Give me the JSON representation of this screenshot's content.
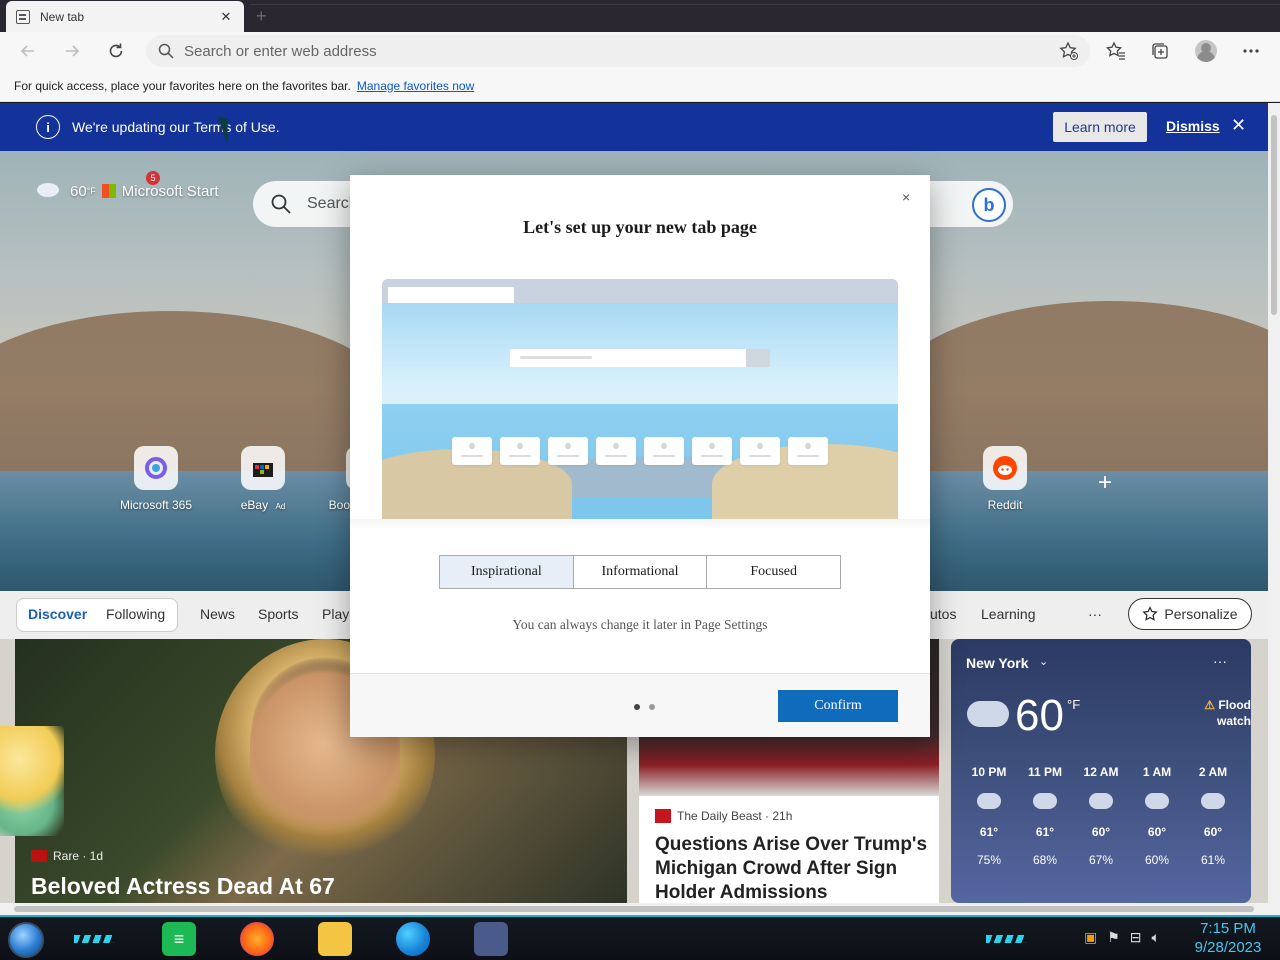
{
  "browser": {
    "tab_title": "New tab",
    "tab_close": "✕",
    "new_tab": "+",
    "address_placeholder": "Search or enter web address",
    "favorites_hint": "For quick access, place your favorites here on the favorites bar.",
    "favorites_link": "Manage favorites now"
  },
  "banner": {
    "icon": "i",
    "message": "We're updating our Terms of Use.",
    "learn_more": "Learn more",
    "dismiss": "Dismiss",
    "close": "✕"
  },
  "ntp": {
    "weather_temp": "60",
    "weather_unit": "°F",
    "brand": "Microsoft Start",
    "notification_count": "5",
    "search_placeholder": "Search",
    "bing_icon": "b",
    "quick_links": [
      {
        "label": "Microsoft 365",
        "icon": "m365-icon"
      },
      {
        "label": "eBay",
        "ad": "Ad",
        "icon": "ebay-icon"
      },
      {
        "label": "Boo",
        "icon": "booking-icon"
      },
      {
        "label": "Reddit",
        "icon": "reddit-icon"
      }
    ],
    "add_link": "+",
    "feed_tabs": {
      "discover": "Discover",
      "following": "Following",
      "news": "News",
      "sports": "Sports",
      "play": "Play",
      "autos": "utos",
      "learning": "Learning",
      "more": "···",
      "personalize": "Personalize"
    },
    "main_card": {
      "source": "Rare · 1d",
      "source_logo": "Rare",
      "headline": "Beloved Actress Dead At 67"
    },
    "news_card": {
      "source": "The Daily Beast · 21h",
      "headline": "Questions Arise Over Trump's Michigan Crowd After Sign Holder Admissions"
    },
    "weather_card": {
      "location": "New York",
      "temp": "60",
      "unit": "°F",
      "alert": "Flood watch",
      "hours": [
        {
          "time": "10 PM",
          "temp": "61°",
          "precip": "75%"
        },
        {
          "time": "11 PM",
          "temp": "61°",
          "precip": "68%"
        },
        {
          "time": "12 AM",
          "temp": "60°",
          "precip": "67%"
        },
        {
          "time": "1 AM",
          "temp": "60°",
          "precip": "60%"
        },
        {
          "time": "2 AM",
          "temp": "60°",
          "precip": "61%"
        }
      ]
    }
  },
  "modal": {
    "close": "×",
    "title": "Let's set up your new tab page",
    "options": [
      "Inspirational",
      "Informational",
      "Focused"
    ],
    "selected_option": "Inspirational",
    "hint": "You can always change it later in Page Settings",
    "confirm": "Confirm",
    "step": 1,
    "total_steps": 2
  },
  "taskbar": {
    "time": "7:15 PM",
    "date": "9/28/2023"
  },
  "colors": {
    "banner_bg": "#13329a",
    "confirm_bg": "#0f6cbd",
    "taskbar_accent": "#15b6d0"
  }
}
